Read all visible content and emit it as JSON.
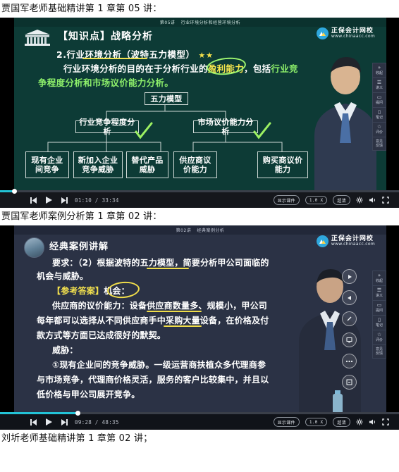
{
  "captions": {
    "first": "贾国军老师基础精讲第 1 章第 05 讲：",
    "second": "贾国军老师案例分析第 1 章第 02 讲：",
    "third": "刘圻老师基础精讲第 1 章第 02 讲；"
  },
  "brand": {
    "name": "正保会计网校",
    "url": "www.chinaacc.com",
    "color": "#2fa8dd"
  },
  "video1": {
    "slide_header_lesson": "第05讲",
    "slide_header_title": "行业环境分析和经营环境分析",
    "knowledge_tag": "【知识点】战略分析",
    "line2": "2.行业环境分析（波特五力模型）",
    "stars": "★★",
    "line3_a": "行业环境分析的目的在于分析行业的",
    "line3_b": "盈利能力",
    "line3_c": "，包括",
    "line3_d": "行业竞",
    "line4_a": "争程度分析和",
    "line4_b": "市场议价能力分析。",
    "diagram": {
      "root": "五力模型",
      "branch_left": "行业竞争程度分析",
      "branch_right": "市场议价能力分析",
      "leaves_left": [
        "现有企业\n间竞争",
        "新加入企业\n竞争威胁",
        "替代产品\n威胁"
      ],
      "leaves_right": [
        "供应商议\n价能力",
        "购买商议价\n能力"
      ]
    },
    "controls": {
      "prev_label": "上一讲",
      "play_label": "播放",
      "next_label": "下一讲",
      "current_time": "01:10",
      "total_time": "33:34",
      "separator": "/",
      "courseware_label": "显示课件",
      "speed_label": "1.0 X",
      "quality_label": "超清",
      "settings_label": "设置",
      "volume_label": "音量",
      "fullscreen_label": "全屏",
      "progress_percent": 3.5
    },
    "sidepanel": [
      {
        "icon": "»",
        "label": "收起"
      },
      {
        "icon": "☰",
        "label": "讲义"
      },
      {
        "icon": "💬",
        "label": "提问"
      },
      {
        "icon": "▯",
        "label": "笔记"
      },
      {
        "icon": "☆",
        "label": "评价"
      },
      {
        "icon": "",
        "label": "意见\n反馈"
      }
    ]
  },
  "video2": {
    "slide_header_lesson": "第02讲",
    "slide_header_title": "经典案例分析",
    "title": "经典案例讲解",
    "line1": "要求：（2）根据波特的五力模型，简要分析甲公司面临的",
    "line2": "机会与威胁。",
    "line3_a": "【参考答案】",
    "line3_b": "机会：",
    "line4": "供应商的议价能力：设备供应商数量多、规模小，甲公司",
    "line5": "每年都可以选择从不同供应商手中采购大量设备，在价格及付",
    "line6": "款方式等方面已达成很好的默契。",
    "line7": "威胁：",
    "line8": "①现有企业间的竞争威胁。一级运营商扶植众多代理商参",
    "line9": "与市场竞争，代理商价格灵活，服务的客户比较集中，并且以",
    "line10": "低价格与甲公司展开竞争。",
    "fabs": [
      {
        "icon": "▶",
        "label": "播放"
      },
      {
        "icon": "◀",
        "label": "上一页"
      },
      {
        "icon": "✎",
        "label": "画笔"
      },
      {
        "icon": "◩",
        "label": "截屏"
      },
      {
        "icon": "•••",
        "label": "更多"
      },
      {
        "icon": "⧉",
        "label": "缩放"
      }
    ],
    "controls": {
      "prev_label": "上一讲",
      "play_label": "播放",
      "next_label": "下一讲",
      "current_time": "09:28",
      "total_time": "48:35",
      "separator": "/",
      "courseware_label": "显示课件",
      "speed_label": "1.0 X",
      "quality_label": "超清",
      "settings_label": "设置",
      "volume_label": "音量",
      "fullscreen_label": "全屏",
      "progress_percent": 19.5
    },
    "sidepanel": [
      {
        "icon": "»",
        "label": "收起"
      },
      {
        "icon": "☰",
        "label": "讲义"
      },
      {
        "icon": "💬",
        "label": "提问"
      },
      {
        "icon": "▯",
        "label": "笔记"
      },
      {
        "icon": "☆",
        "label": "评价"
      },
      {
        "icon": "",
        "label": "意见\n反馈"
      }
    ]
  }
}
